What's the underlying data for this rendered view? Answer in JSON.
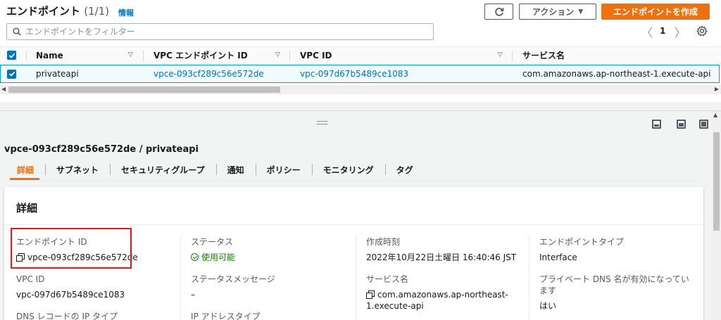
{
  "header": {
    "title": "エンドポイント",
    "count": "(1/1)",
    "info": "情報"
  },
  "toolbar": {
    "action_label": "アクション",
    "create_label": "エンドポイントを作成"
  },
  "search": {
    "placeholder": "エンドポイントをフィルター"
  },
  "pager": {
    "prev": "〈",
    "page": "1",
    "next": "〉"
  },
  "table": {
    "columns": [
      "Name",
      "VPC エンドポイント ID",
      "VPC ID",
      "サービス名"
    ],
    "rows": [
      {
        "name": "privateapi",
        "endpoint_id": "vpce-093cf289c56e572de",
        "vpc_id": "vpc-097d67b5489ce1083",
        "service": "com.amazonaws.ap-northeast-1.execute-api"
      }
    ]
  },
  "detail": {
    "title": "vpce-093cf289c56e572de / privateapi",
    "tabs": [
      "詳細",
      "サブネット",
      "セキュリティグループ",
      "通知",
      "ポリシー",
      "モニタリング",
      "タグ"
    ],
    "panel_title": "詳細",
    "fields": {
      "endpoint_id_label": "エンドポイント ID",
      "endpoint_id_value": "vpce-093cf289c56e572de",
      "vpc_id_label": "VPC ID",
      "vpc_id_value": "vpc-097d67b5489ce1083",
      "dns_record_label": "DNS レコードの IP タイプ",
      "status_label": "ステータス",
      "status_value": "使用可能",
      "status_message_label": "ステータスメッセージ",
      "status_message_value": "–",
      "ip_address_type_label": "IP アドレスタイプ",
      "created_label": "作成時刻",
      "created_value": "2022年10月22日土曜日 16:40:46 JST",
      "service_label": "サービス名",
      "service_value_line1": "com.amazonaws.ap-northeast-",
      "service_value_line2": "1.execute-api",
      "endpoint_type_label": "エンドポイントタイプ",
      "endpoint_type_value": "Interface",
      "private_dns_label_line1": "プライベート DNS 名が有効になってい",
      "private_dns_label_line2": "ます",
      "private_dns_value": "はい"
    }
  },
  "colors": {
    "accent": "#ec7211",
    "link": "#0073bb",
    "success": "#1d8102",
    "highlight": "#e2171b"
  }
}
